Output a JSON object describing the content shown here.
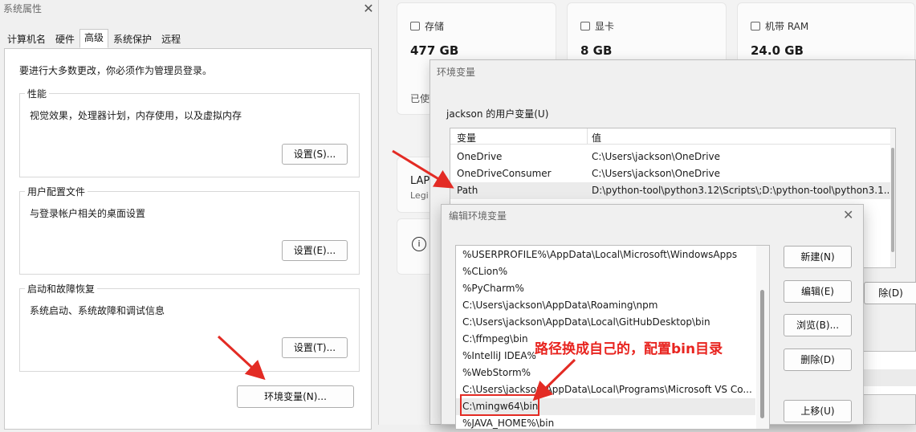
{
  "system_properties": {
    "title": "系统属性",
    "tabs": [
      "计算机名",
      "硬件",
      "高级",
      "系统保护",
      "远程"
    ],
    "active_tab": "高级",
    "notice": "要进行大多数更改，你必须作为管理员登录。",
    "performance": {
      "legend": "性能",
      "desc": "视觉效果，处理器计划，内存使用，以及虚拟内存",
      "button": "设置(S)..."
    },
    "user_profile": {
      "legend": "用户配置文件",
      "desc": "与登录帐户相关的桌面设置",
      "button": "设置(E)..."
    },
    "startup": {
      "legend": "启动和故障恢复",
      "desc": "系统启动、系统故障和调试信息",
      "button": "设置(T)..."
    },
    "env_button": "环境变量(N)..."
  },
  "settings_page": {
    "storage": {
      "label": "存储",
      "value": "477 GB"
    },
    "gpu": {
      "label": "显卡",
      "value": "8 GB"
    },
    "ram": {
      "label": "机带 RAM",
      "value": "24.0 GB"
    },
    "partial_used": "已使",
    "partial_lap": "LAP",
    "partial_legi": "Legi"
  },
  "env_dialog": {
    "title": "环境变量",
    "user_vars_label": "jackson 的用户变量(U)",
    "columns": [
      "变量",
      "值"
    ],
    "rows": [
      {
        "name": "OneDrive",
        "value": "C:\\Users\\jackson\\OneDrive"
      },
      {
        "name": "OneDriveConsumer",
        "value": "C:\\Users\\jackson\\OneDrive"
      },
      {
        "name": "Path",
        "value": "D:\\python-tool\\python3.12\\Scripts\\;D:\\python-tool\\python3.1..."
      }
    ],
    "delete_partial": "除(D)"
  },
  "edit_dialog": {
    "title": "编辑环境变量",
    "paths": [
      "%USERPROFILE%\\AppData\\Local\\Microsoft\\WindowsApps",
      "%CLion%",
      "%PyCharm%",
      "C:\\Users\\jackson\\AppData\\Roaming\\npm",
      "C:\\Users\\jackson\\AppData\\Local\\GitHubDesktop\\bin",
      "C:\\ffmpeg\\bin",
      "%IntelliJ IDEA%",
      "%WebStorm%",
      "C:\\Users\\jackson\\AppData\\Local\\Programs\\Microsoft VS Co...",
      "C:\\mingw64\\bin",
      "%JAVA_HOME%\\bin"
    ],
    "buttons": {
      "new": "新建(N)",
      "edit": "编辑(E)",
      "browse": "浏览(B)...",
      "delete": "删除(D)",
      "move_up": "上移(U)"
    }
  },
  "annotation": "路径换成自己的，配置bin目录",
  "colors": {
    "accent_red": "#e32b24"
  }
}
